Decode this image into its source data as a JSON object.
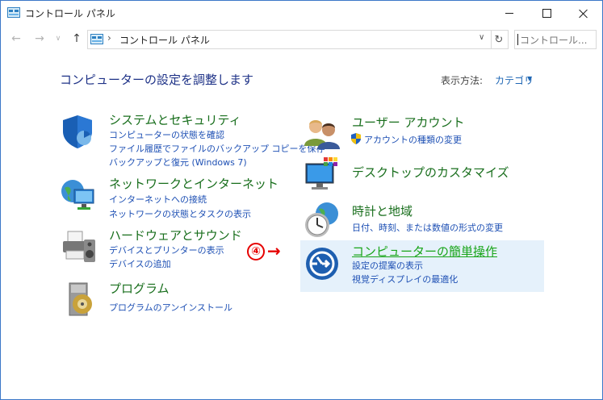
{
  "window": {
    "title": "コントロール パネル",
    "controls": {
      "minimize": "minimize",
      "maximize": "maximize",
      "close": "close"
    }
  },
  "nav": {
    "address_separator": "›",
    "address_path": "コントロール パネル",
    "address_dropdown": "∨",
    "refresh": "↻",
    "search_placeholder": "コントロール..."
  },
  "main": {
    "heading": "コンピューターの設定を調整します",
    "view_by_label": "表示方法:",
    "view_by_value": "カテゴリ",
    "view_by_arrow": "▼"
  },
  "categories": [
    {
      "title": "システムとセキュリティ",
      "icon": "shield-icon",
      "links": [
        "コンピューターの状態を確認",
        "ファイル履歴でファイルのバックアップ コピーを保存",
        "バックアップと復元 (Windows 7)"
      ]
    },
    {
      "title": "ネットワークとインターネット",
      "icon": "network-globe-icon",
      "links": [
        "インターネットへの接続",
        "ネットワークの状態とタスクの表示"
      ]
    },
    {
      "title": "ハードウェアとサウンド",
      "icon": "printer-speaker-icon",
      "links": [
        "デバイスとプリンターの表示",
        "デバイスの追加"
      ]
    },
    {
      "title": "プログラム",
      "icon": "programs-disc-icon",
      "links": [
        "プログラムのアンインストール"
      ]
    },
    {
      "title": "ユーザー アカウント",
      "icon": "users-icon",
      "links": [
        "アカウントの種類の変更"
      ]
    },
    {
      "title": "デスクトップのカスタマイズ",
      "icon": "monitor-palette-icon",
      "links": []
    },
    {
      "title": "時計と地域",
      "icon": "clock-globe-icon",
      "subtitle": "日付、時刻、または数値の形式の変更",
      "links": []
    },
    {
      "title": "コンピューターの簡単操作",
      "icon": "ease-of-access-icon",
      "links": [
        "設定の提案の表示",
        "視覚ディスプレイの最適化"
      ]
    }
  ],
  "annotation": {
    "step": "④",
    "arrow": "→"
  },
  "colors": {
    "link": "#1e50b4",
    "category_title": "#186e1c",
    "heading": "#1e3287",
    "highlight_bg": "#e5f1fb",
    "annotation": "#e60000"
  }
}
